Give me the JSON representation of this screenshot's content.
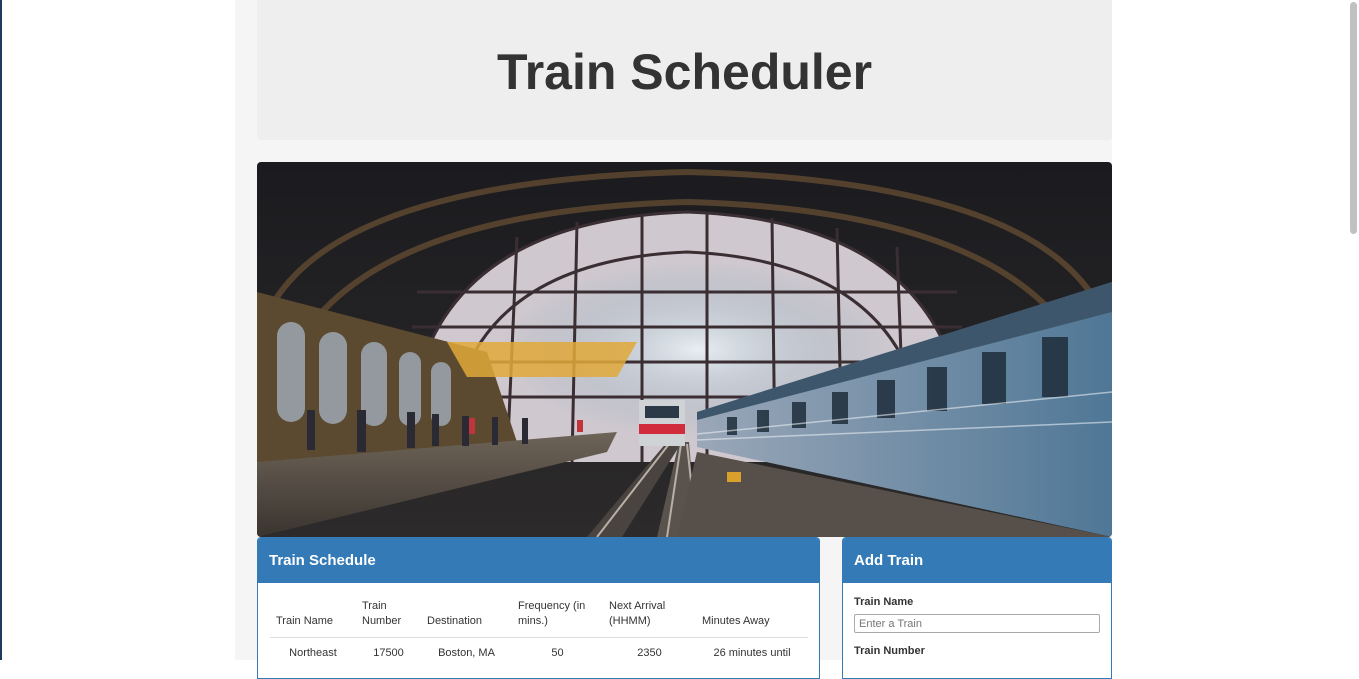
{
  "header": {
    "title": "Train Scheduler"
  },
  "schedule_panel": {
    "title": "Train Schedule",
    "columns": [
      "Train Name",
      "Train Number",
      "Destination",
      "Frequency (in mins.)",
      "Next Arrival (HHMM)",
      "Minutes Away"
    ],
    "rows": [
      [
        "Northeast",
        "17500",
        "Boston, MA",
        "50",
        "2350",
        "26 minutes until"
      ]
    ]
  },
  "add_panel": {
    "title": "Add Train",
    "train_name_label": "Train Name",
    "train_name_placeholder": "Enter a Train",
    "train_number_label": "Train Number"
  },
  "colors": {
    "panel_primary": "#337ab7",
    "jumbotron_bg": "#eeeeee",
    "container_bg": "#f5f5f5"
  },
  "icons": {
    "hero_image": "train-station-photo"
  }
}
